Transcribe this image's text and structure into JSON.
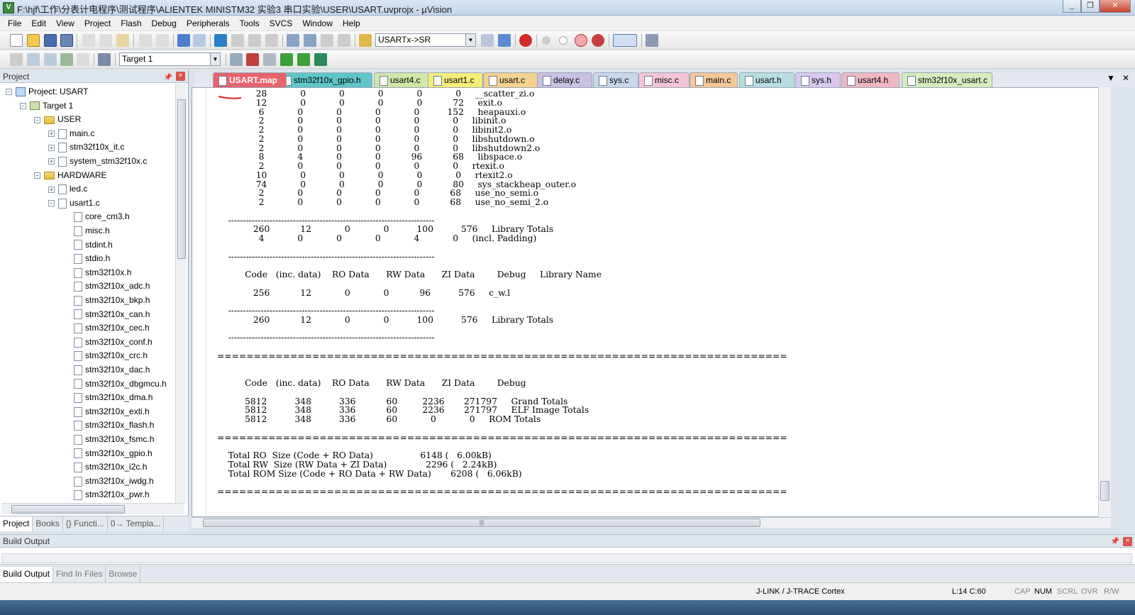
{
  "window": {
    "title": "F:\\hjf\\工作\\分表计电程序\\测试程序\\ALIENTEK MINISTM32 实验3 串口实验\\USER\\USART.uvprojx - µVision",
    "controls": [
      "_",
      "❐",
      "✕"
    ]
  },
  "menu": [
    "File",
    "Edit",
    "View",
    "Project",
    "Flash",
    "Debug",
    "Peripherals",
    "Tools",
    "SVCS",
    "Window",
    "Help"
  ],
  "toolbar": {
    "find_field": "USARTx->SR",
    "target_select": "Target 1"
  },
  "project_panel": {
    "title": "Project",
    "tree": [
      {
        "level": 0,
        "type": "proj",
        "label": "Project: USART",
        "exp": "−"
      },
      {
        "level": 1,
        "type": "target",
        "label": "Target 1",
        "exp": "−"
      },
      {
        "level": 2,
        "type": "folder",
        "label": "USER",
        "exp": "−"
      },
      {
        "level": 3,
        "type": "file",
        "label": "main.c",
        "exp": "+"
      },
      {
        "level": 3,
        "type": "file",
        "label": "stm32f10x_it.c",
        "exp": "+"
      },
      {
        "level": 3,
        "type": "file",
        "label": "system_stm32f10x.c",
        "exp": "+"
      },
      {
        "level": 2,
        "type": "folder",
        "label": "HARDWARE",
        "exp": "−"
      },
      {
        "level": 3,
        "type": "file",
        "label": "led.c",
        "exp": "+"
      },
      {
        "level": 3,
        "type": "file",
        "label": "usart1.c",
        "exp": "−"
      },
      {
        "level": 4,
        "type": "file",
        "label": "core_cm3.h",
        "exp": ""
      },
      {
        "level": 4,
        "type": "file",
        "label": "misc.h",
        "exp": ""
      },
      {
        "level": 4,
        "type": "file",
        "label": "stdint.h",
        "exp": ""
      },
      {
        "level": 4,
        "type": "file",
        "label": "stdio.h",
        "exp": ""
      },
      {
        "level": 4,
        "type": "file",
        "label": "stm32f10x.h",
        "exp": ""
      },
      {
        "level": 4,
        "type": "file",
        "label": "stm32f10x_adc.h",
        "exp": ""
      },
      {
        "level": 4,
        "type": "file",
        "label": "stm32f10x_bkp.h",
        "exp": ""
      },
      {
        "level": 4,
        "type": "file",
        "label": "stm32f10x_can.h",
        "exp": ""
      },
      {
        "level": 4,
        "type": "file",
        "label": "stm32f10x_cec.h",
        "exp": ""
      },
      {
        "level": 4,
        "type": "file",
        "label": "stm32f10x_conf.h",
        "exp": ""
      },
      {
        "level": 4,
        "type": "file",
        "label": "stm32f10x_crc.h",
        "exp": ""
      },
      {
        "level": 4,
        "type": "file",
        "label": "stm32f10x_dac.h",
        "exp": ""
      },
      {
        "level": 4,
        "type": "file",
        "label": "stm32f10x_dbgmcu.h",
        "exp": ""
      },
      {
        "level": 4,
        "type": "file",
        "label": "stm32f10x_dma.h",
        "exp": ""
      },
      {
        "level": 4,
        "type": "file",
        "label": "stm32f10x_exti.h",
        "exp": ""
      },
      {
        "level": 4,
        "type": "file",
        "label": "stm32f10x_flash.h",
        "exp": ""
      },
      {
        "level": 4,
        "type": "file",
        "label": "stm32f10x_fsmc.h",
        "exp": ""
      },
      {
        "level": 4,
        "type": "file",
        "label": "stm32f10x_gpio.h",
        "exp": ""
      },
      {
        "level": 4,
        "type": "file",
        "label": "stm32f10x_i2c.h",
        "exp": ""
      },
      {
        "level": 4,
        "type": "file",
        "label": "stm32f10x_iwdg.h",
        "exp": ""
      },
      {
        "level": 4,
        "type": "file",
        "label": "stm32f10x_pwr.h",
        "exp": ""
      }
    ],
    "tabs": [
      "Project",
      "Books",
      "{} Functi...",
      "0→ Templa..."
    ]
  },
  "editor_tabs": [
    {
      "label": "USART.map",
      "color": "#e8636b",
      "active": true
    },
    {
      "label": "stm32f10x_gpio.h",
      "color": "#5fc6c9"
    },
    {
      "label": "usart4.c",
      "color": "#cfe7a8"
    },
    {
      "label": "usart1.c",
      "color": "#f3ee7a"
    },
    {
      "label": "usart.c",
      "color": "#f5d28e"
    },
    {
      "label": "delay.c",
      "color": "#c9c0e2"
    },
    {
      "label": "sys.c",
      "color": "#c7d8ea"
    },
    {
      "label": "misc.c",
      "color": "#f4c4d8"
    },
    {
      "label": "main.c",
      "color": "#f5c79a"
    },
    {
      "label": "usart.h",
      "color": "#b8dede"
    },
    {
      "label": "sys.h",
      "color": "#d8c8ee"
    },
    {
      "label": "usart4.h",
      "color": "#f0b8c2"
    },
    {
      "label": "stm32f10x_usart.c",
      "color": "#d6ecc0"
    }
  ],
  "editor_lines": [
    "              28            0            0            0            0            0     __scatter_zi.o",
    "              12            0            0            0            0           72     exit.o",
    "               6            0            0            0            0          152     heapauxi.o",
    "               2            0            0            0            0            0     libinit.o",
    "               2            0            0            0            0            0     libinit2.o",
    "               2            0            0            0            0            0     libshutdown.o",
    "               2            0            0            0            0            0     libshutdown2.o",
    "               8            4            0            0           96           68     libspace.o",
    "               2            0            0            0            0            0     rtexit.o",
    "              10            0            0            0            0            0     rtexit2.o",
    "              74            0            0            0            0           80     sys_stackheap_outer.o",
    "               2            0            0            0            0           68     use_no_semi.o",
    "               2            0            0            0            0           68     use_no_semi_2.o",
    "",
    "    ----------------------------------------------------------------------",
    "             260           12            0            0          100          576     Library Totals",
    "               4            0            0            0            4            0     (incl. Padding)",
    "",
    "    ----------------------------------------------------------------------",
    "",
    "          Code   (inc. data)    RO Data      RW Data      ZI Data        Debug     Library Name",
    "",
    "             256           12            0            0           96          576     c_w.l",
    "",
    "    ----------------------------------------------------------------------",
    "             260           12            0            0          100          576     Library Totals",
    "",
    "    ----------------------------------------------------------------------",
    "",
    "==============================================================================",
    "",
    "",
    "          Code   (inc. data)    RO Data      RW Data      ZI Data        Debug",
    "",
    "          5812          348          336           60         2236       271797     Grand Totals",
    "          5812          348          336           60         2236       271797     ELF Image Totals",
    "          5812          348          336           60            0            0     ROM Totals",
    "",
    "==============================================================================",
    "",
    "    Total RO  Size (Code + RO Data)                 6148 (   6.00kB)",
    "    Total RW  Size (RW Data + ZI Data)              2296 (   2.24kB)",
    "    Total ROM Size (Code + RO Data + RW Data)       6208 (   6.06kB)",
    "",
    "=============================================================================="
  ],
  "build_output": {
    "title": "Build Output",
    "tabs": [
      "Build Output",
      "Find In Files",
      "Browse"
    ]
  },
  "statusbar": {
    "debugger": "J-LINK / J-TRACE Cortex",
    "position": "L:14 C:60",
    "indicators": [
      "CAP",
      "NUM",
      "SCRL",
      "OVR",
      "R/W"
    ]
  }
}
